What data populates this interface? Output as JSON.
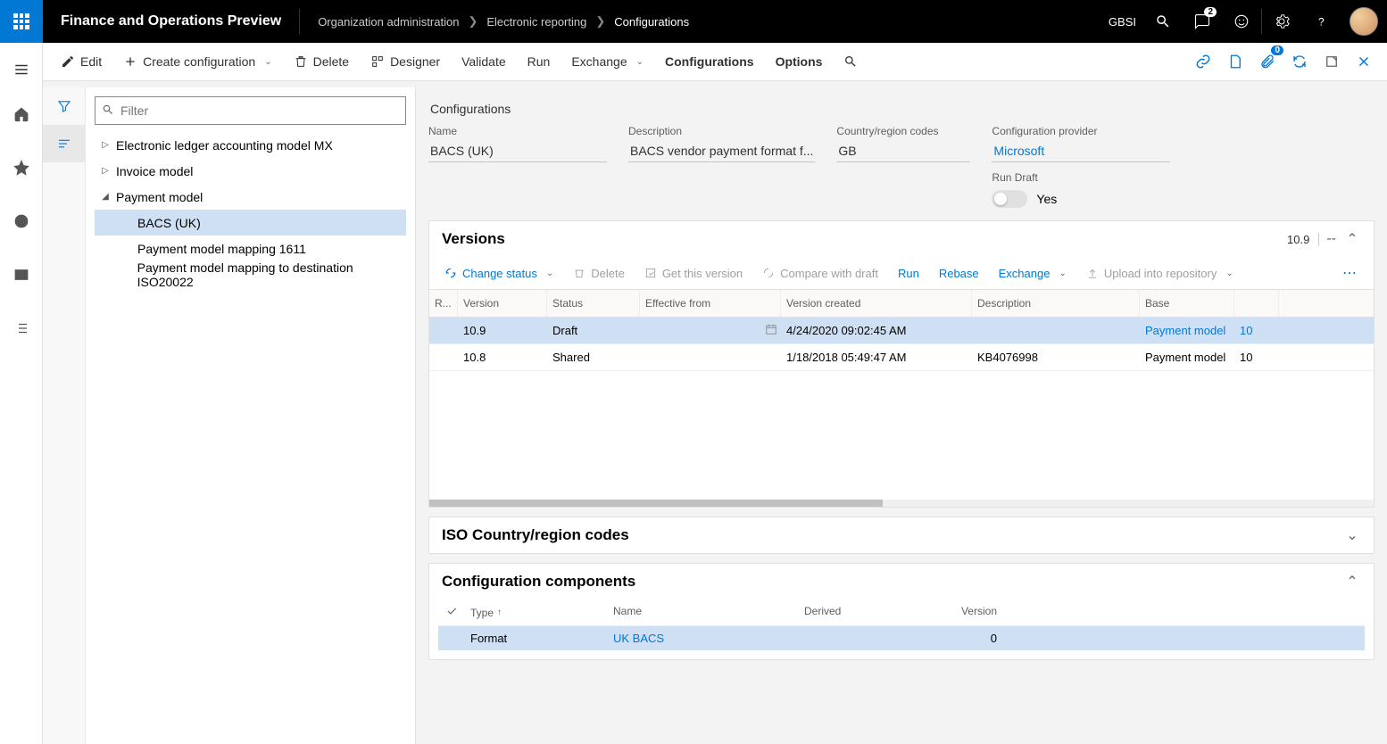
{
  "header": {
    "app_title": "Finance and Operations Preview",
    "breadcrumbs": [
      "Organization administration",
      "Electronic reporting",
      "Configurations"
    ],
    "company": "GBSI",
    "notification_count": "2"
  },
  "cmdbar": {
    "edit": "Edit",
    "create": "Create configuration",
    "delete": "Delete",
    "designer": "Designer",
    "validate": "Validate",
    "run": "Run",
    "exchange": "Exchange",
    "configurations": "Configurations",
    "options": "Options",
    "attach_count": "0"
  },
  "tree": {
    "filter_placeholder": "Filter",
    "items": [
      {
        "label": "Electronic ledger accounting model MX",
        "expanded": false,
        "level": 0
      },
      {
        "label": "Invoice model",
        "expanded": false,
        "level": 0
      },
      {
        "label": "Payment model",
        "expanded": true,
        "level": 0
      },
      {
        "label": "BACS (UK)",
        "level": 1,
        "selected": true
      },
      {
        "label": "Payment model mapping 1611",
        "level": 1
      },
      {
        "label": "Payment model mapping to destination ISO20022",
        "level": 1
      }
    ]
  },
  "details": {
    "section": "Configurations",
    "name_label": "Name",
    "name_value": "BACS (UK)",
    "desc_label": "Description",
    "desc_value": "BACS vendor payment format f...",
    "country_label": "Country/region codes",
    "country_value": "GB",
    "provider_label": "Configuration provider",
    "provider_value": "Microsoft",
    "run_draft_label": "Run Draft",
    "run_draft_value": "Yes"
  },
  "versions": {
    "title": "Versions",
    "meta": "10.9",
    "toolbar": {
      "change_status": "Change status",
      "delete": "Delete",
      "get_version": "Get this version",
      "compare": "Compare with draft",
      "run": "Run",
      "rebase": "Rebase",
      "exchange": "Exchange",
      "upload": "Upload into repository"
    },
    "columns": [
      "R...",
      "Version",
      "Status",
      "Effective from",
      "Version created",
      "Description",
      "Base",
      ""
    ],
    "rows": [
      {
        "version": "10.9",
        "status": "Draft",
        "effective": "",
        "created": "4/24/2020 09:02:45 AM",
        "desc": "",
        "base": "Payment model",
        "basever": "10",
        "selected": true,
        "link": true
      },
      {
        "version": "10.8",
        "status": "Shared",
        "effective": "",
        "created": "1/18/2018 05:49:47 AM",
        "desc": "KB4076998",
        "base": "Payment model",
        "basever": "10"
      }
    ]
  },
  "iso_panel": {
    "title": "ISO Country/region codes"
  },
  "components": {
    "title": "Configuration components",
    "columns": {
      "type": "Type",
      "name": "Name",
      "derived": "Derived",
      "version": "Version"
    },
    "row": {
      "type": "Format",
      "name": "UK BACS",
      "derived": "",
      "version": "0"
    }
  }
}
